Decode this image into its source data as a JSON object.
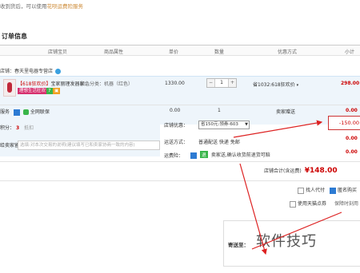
{
  "notice": {
    "text": "收到货后，可以使用",
    "link": "花呗运费险服务"
  },
  "section_title": "订单信息",
  "columns": [
    "店铺宝贝",
    "商品属性",
    "单价",
    "数量",
    "优惠方式",
    "小计"
  ],
  "shop": {
    "label": "店铺：春天里电器专营店"
  },
  "product": {
    "name_prefix": "【618狂欢价】",
    "name": "宝家丽理发器家...",
    "attr": "颜色分类：机器（红色）",
    "tag_text": "理想生活狂欢节",
    "tag2": "7",
    "price": "1330.00",
    "quantity": "1",
    "promo": "省1032:618狂欢价",
    "subtotal": "298.00"
  },
  "service": {
    "label": "服务",
    "insurance": "全网联保",
    "price": "0.00",
    "qty": "1",
    "seller_send": "卖家赠送",
    "subtotal": "0.00"
  },
  "points": {
    "label": "积分：",
    "value": "3",
    "unit": "抵扣"
  },
  "message": {
    "label": "给卖家留言：",
    "placeholder": "选填:对本次交易的说明(建议填写已和卖家协商一致的内容)"
  },
  "store_coupon": {
    "label": "店铺优惠：",
    "value": "省150元:领券-603",
    "discount": "-150.00"
  },
  "shipping": {
    "label": "运送方式：",
    "value": "普通配送 快递 免邮",
    "price": "0.00"
  },
  "freight_ins": {
    "label": "运费险：",
    "badge": "退",
    "text": "卖家送,确认收货前退货可赔",
    "price": "0.00"
  },
  "total": {
    "label": "店铺合计(含运费)",
    "amount": "¥148.00"
  },
  "options": {
    "anonymous": "匿名购买",
    "pay_for_other": "找人代付",
    "tmall_points": "使用天猫点券",
    "ins_exchange": "保障时刻用"
  },
  "address": {
    "label": "寄送至："
  },
  "watermark": "软件技巧"
}
